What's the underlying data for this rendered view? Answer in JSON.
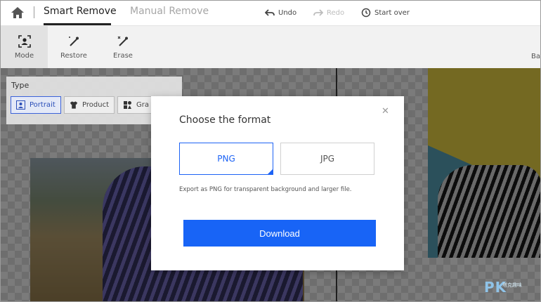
{
  "topbar": {
    "tabs": [
      {
        "label": "Smart Remove",
        "active": true
      },
      {
        "label": "Manual Remove",
        "active": false
      }
    ],
    "undo_label": "Undo",
    "redo_label": "Redo",
    "startover_label": "Start over"
  },
  "toolbar": {
    "items": [
      {
        "label": "Mode",
        "icon": "person-frame-icon",
        "active": true
      },
      {
        "label": "Restore",
        "icon": "brush-icon"
      },
      {
        "label": "Erase",
        "icon": "eraser-icon"
      }
    ],
    "right_label": "Ba"
  },
  "type_panel": {
    "title": "Type",
    "options": [
      {
        "label": "Portrait",
        "icon": "portrait-icon",
        "active": true
      },
      {
        "label": "Product",
        "icon": "shirt-icon"
      },
      {
        "label": "Gra",
        "icon": "shapes-icon"
      }
    ]
  },
  "modal": {
    "title": "Choose the format",
    "close_icon": "close-icon",
    "formats": [
      {
        "label": "PNG",
        "selected": true
      },
      {
        "label": "JPG",
        "selected": false
      }
    ],
    "hint": "Export as PNG for transparent background and larger file.",
    "download_label": "Download"
  },
  "watermark": {
    "text": "PK",
    "sub": "塔克趣味"
  },
  "colors": {
    "accent": "#1864f6",
    "active_chip": "#3b62d9"
  }
}
